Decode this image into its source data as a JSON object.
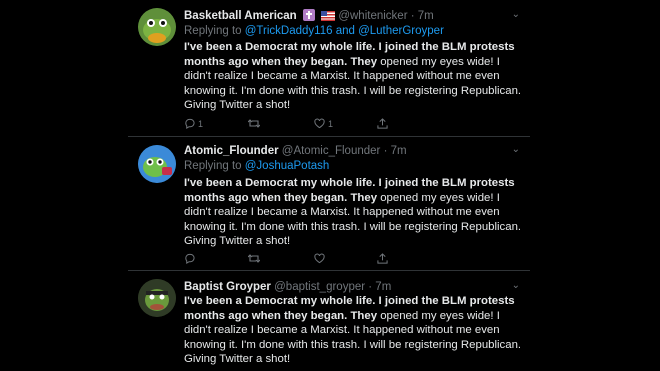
{
  "tweets": [
    {
      "name": "Basketball American",
      "handle": "@whitenicker",
      "time": "· 7m",
      "reply_prefix": "Replying to",
      "reply_to_1": "@TrickDaddy116",
      "reply_and": "and",
      "reply_to_2": "@LutherGroyper",
      "text_bold_1": "I've been a Democrat my whole life. I joined the BLM protests months ago when they began. They",
      "text_rest_1": "opened my eyes wide! I didn't realize I became a Marxist. It happened without me even knowing it. I'm done with this trash. I will be registering Republican. Giving Twitter a shot!",
      "replies": "1",
      "retweets": "",
      "likes": "1"
    },
    {
      "name": "Atomic_Flounder",
      "handle": "@Atomic_Flounder",
      "time": "· 7m",
      "reply_prefix": "Replying to",
      "reply_to_1": "@JoshuaPotash",
      "text_bold_1": "I've been a Democrat my whole life. I joined the BLM protests months ago when they began. They",
      "text_rest_1": "opened my eyes wide! I didn't realize I became a Marxist. It happened without me even knowing it. I'm done with this trash. I will be registering Republican. Giving Twitter a shot!",
      "replies": "",
      "retweets": "",
      "likes": ""
    },
    {
      "name": "Baptist Groyper",
      "handle": "@baptist_groyper",
      "time": "· 7m",
      "text_bold_1": "I've been a Democrat my whole life. I joined the BLM protests months ago when they began. They",
      "text_rest_1": "opened my eyes wide! I didn't realize I became a Marxist. It happened without me even knowing it. I'm done with this trash. I will be registering Republican. Giving Twitter a shot!"
    }
  ],
  "colors": {
    "background": "#000000",
    "link": "#1d9bf0",
    "muted": "#71767b",
    "text": "#e7e9ea"
  },
  "icons": [
    "reply-icon",
    "retweet-icon",
    "like-icon",
    "share-icon",
    "caret-down-icon",
    "cross-badge-icon",
    "flag-icon"
  ]
}
